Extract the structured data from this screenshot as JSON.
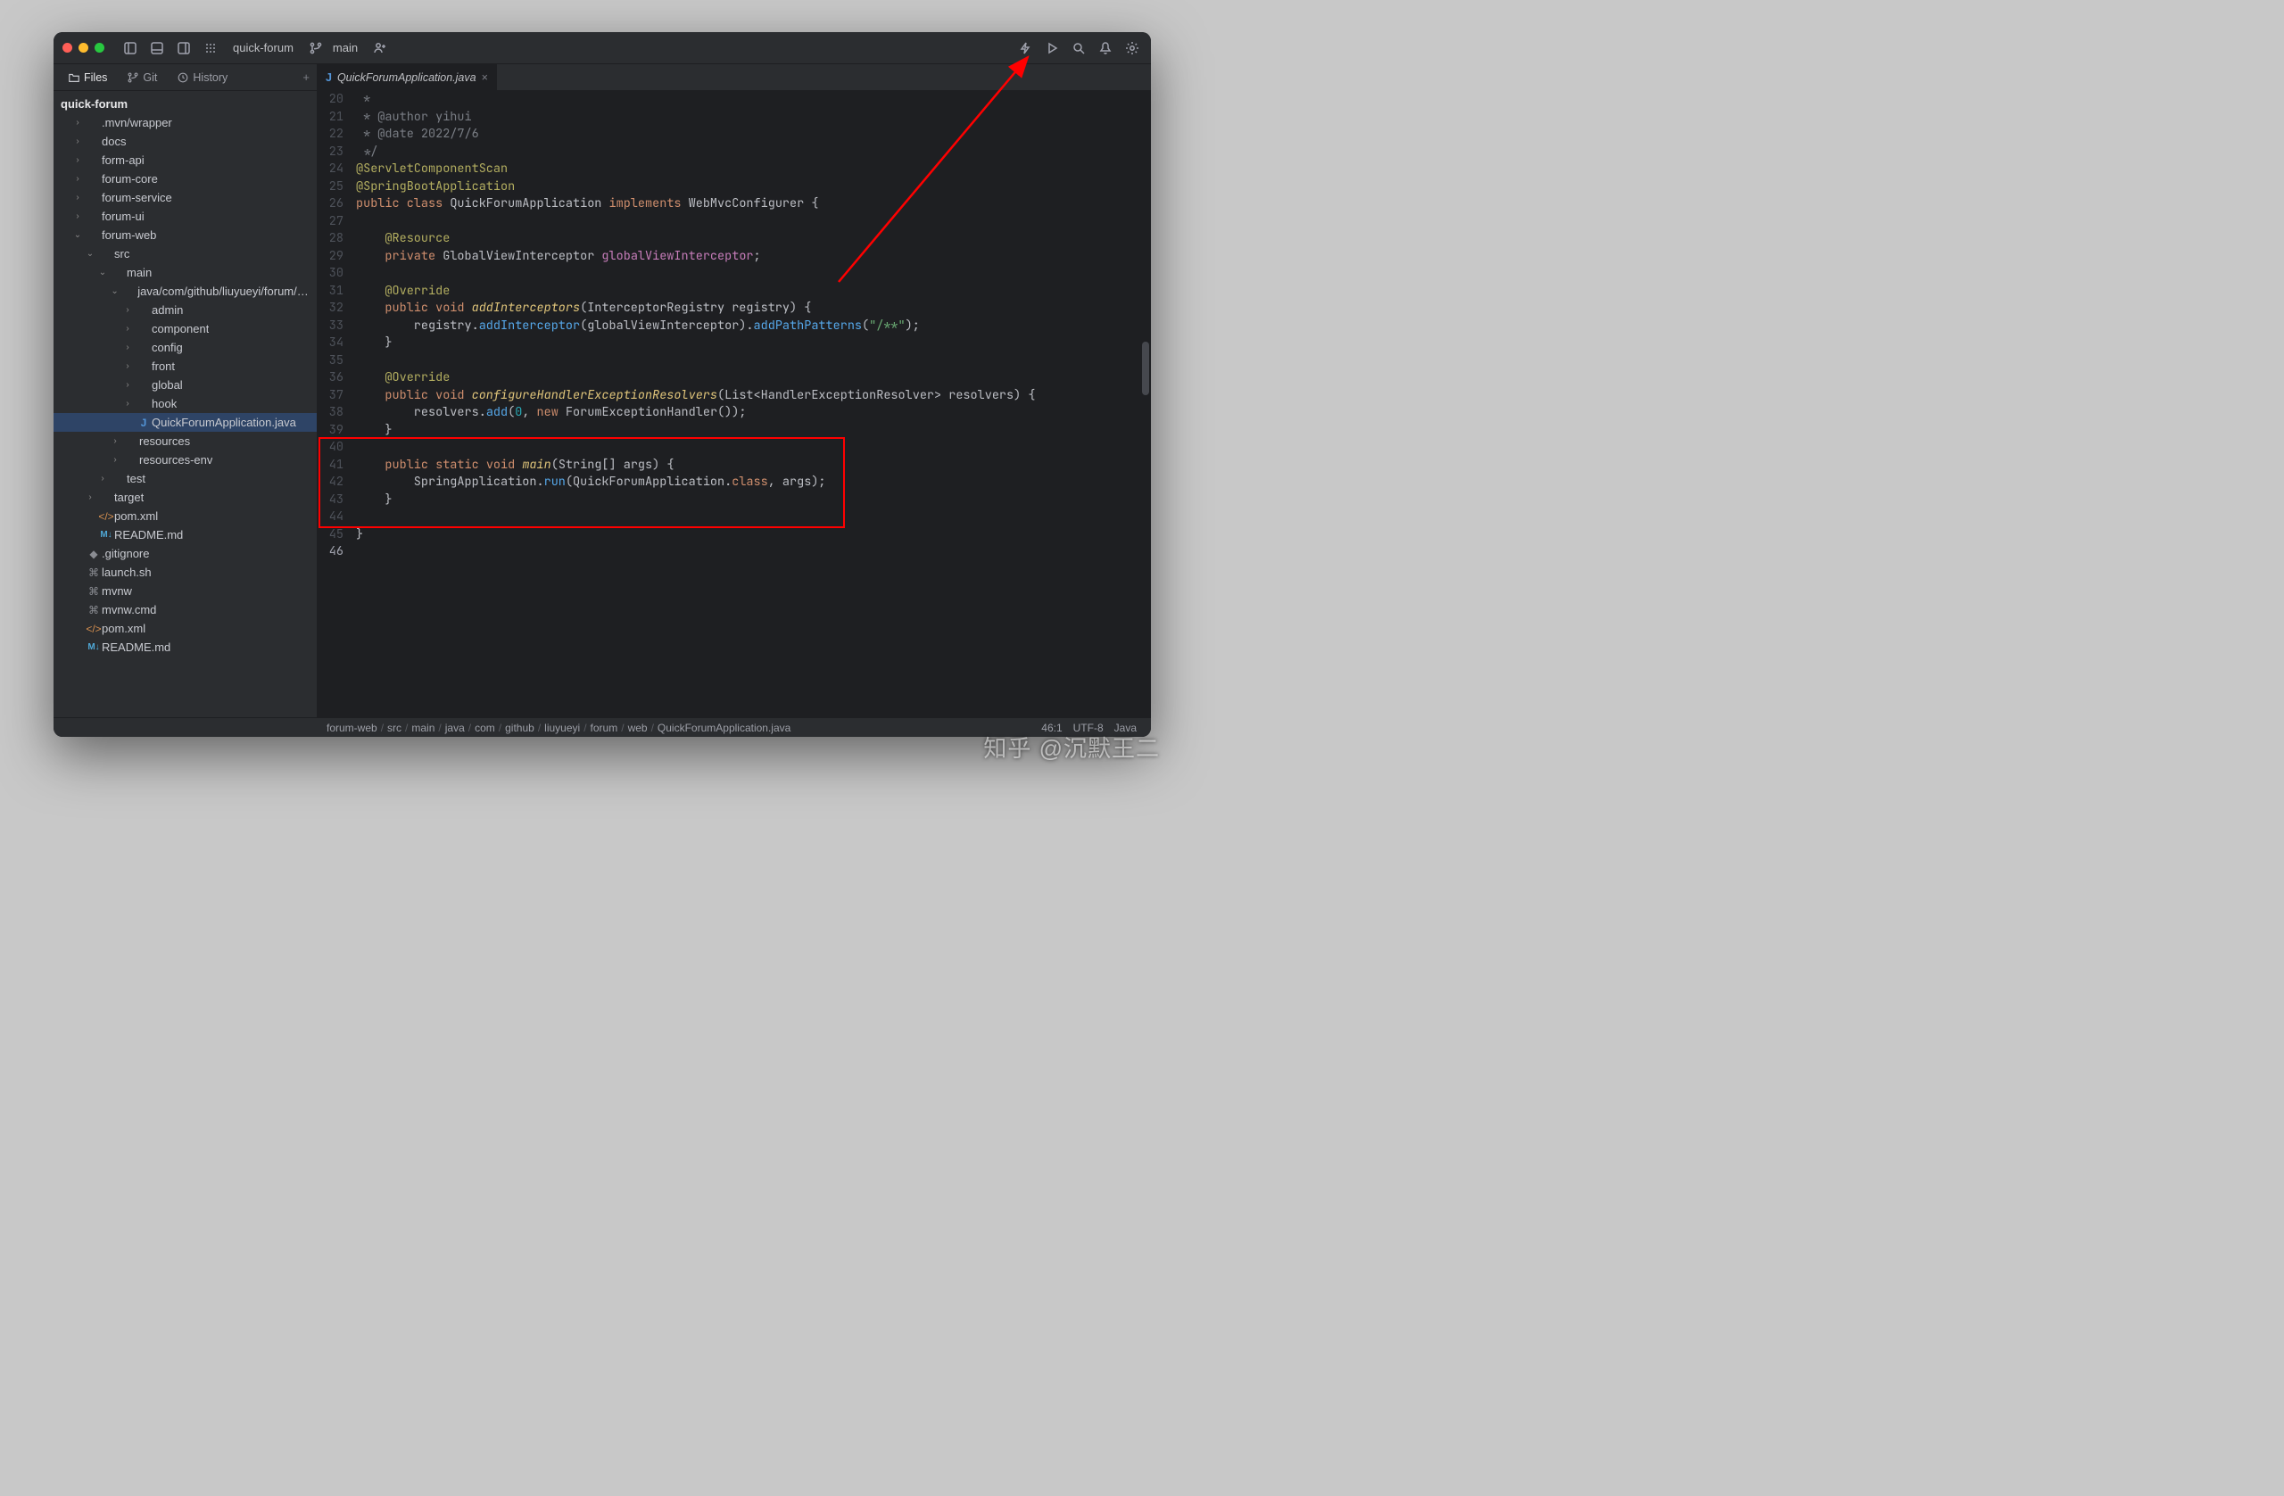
{
  "titlebar": {
    "project": "quick-forum",
    "branch": "main"
  },
  "sidebar_tabs": {
    "files": "Files",
    "git": "Git",
    "history": "History"
  },
  "editor_tab": {
    "icon": "J",
    "name": "QuickForumApplication.java"
  },
  "tree": {
    "root": "quick-forum",
    "nodes": [
      {
        "d": 1,
        "e": "r",
        "i": "folder",
        "l": ".mvn/wrapper"
      },
      {
        "d": 1,
        "e": "r",
        "i": "folder",
        "l": "docs"
      },
      {
        "d": 1,
        "e": "r",
        "i": "folder",
        "l": "form-api"
      },
      {
        "d": 1,
        "e": "r",
        "i": "folder",
        "l": "forum-core"
      },
      {
        "d": 1,
        "e": "r",
        "i": "folder",
        "l": "forum-service"
      },
      {
        "d": 1,
        "e": "r",
        "i": "folder",
        "l": "forum-ui"
      },
      {
        "d": 1,
        "e": "d",
        "i": "folder",
        "l": "forum-web"
      },
      {
        "d": 2,
        "e": "d",
        "i": "folder",
        "l": "src"
      },
      {
        "d": 3,
        "e": "d",
        "i": "folder",
        "l": "main"
      },
      {
        "d": 4,
        "e": "d",
        "i": "folder",
        "l": "java/com/github/liuyueyi/forum/web"
      },
      {
        "d": 5,
        "e": "r",
        "i": "folder",
        "l": "admin"
      },
      {
        "d": 5,
        "e": "r",
        "i": "folder",
        "l": "component"
      },
      {
        "d": 5,
        "e": "r",
        "i": "folder",
        "l": "config"
      },
      {
        "d": 5,
        "e": "r",
        "i": "folder",
        "l": "front"
      },
      {
        "d": 5,
        "e": "r",
        "i": "folder",
        "l": "global"
      },
      {
        "d": 5,
        "e": "r",
        "i": "folder",
        "l": "hook"
      },
      {
        "d": 5,
        "e": " ",
        "i": "java",
        "l": "QuickForumApplication.java",
        "sel": true
      },
      {
        "d": 4,
        "e": "r",
        "i": "folder",
        "l": "resources"
      },
      {
        "d": 4,
        "e": "r",
        "i": "folder",
        "l": "resources-env"
      },
      {
        "d": 3,
        "e": "r",
        "i": "folder",
        "l": "test"
      },
      {
        "d": 2,
        "e": "r",
        "i": "folder",
        "l": "target"
      },
      {
        "d": 2,
        "e": " ",
        "i": "xml",
        "l": "pom.xml"
      },
      {
        "d": 2,
        "e": " ",
        "i": "md",
        "l": "README.md"
      },
      {
        "d": 1,
        "e": " ",
        "i": "git",
        "l": ".gitignore"
      },
      {
        "d": 1,
        "e": " ",
        "i": "sh",
        "l": "launch.sh"
      },
      {
        "d": 1,
        "e": " ",
        "i": "sh",
        "l": "mvnw"
      },
      {
        "d": 1,
        "e": " ",
        "i": "sh",
        "l": "mvnw.cmd"
      },
      {
        "d": 1,
        "e": " ",
        "i": "xml",
        "l": "pom.xml"
      },
      {
        "d": 1,
        "e": " ",
        "i": "md",
        "l": "README.md"
      }
    ]
  },
  "code": {
    "start": 20,
    "lines": [
      [
        [
          "c",
          " *"
        ]
      ],
      [
        [
          "c",
          " * @author yihui"
        ]
      ],
      [
        [
          "c",
          " * @date 2022/7/6"
        ]
      ],
      [
        [
          "c",
          " */"
        ]
      ],
      [
        [
          "a",
          "@ServletComponentScan"
        ]
      ],
      [
        [
          "a",
          "@SpringBootApplication"
        ]
      ],
      [
        [
          "k",
          "public "
        ],
        [
          "k",
          "class "
        ],
        [
          "t",
          "QuickForumApplication "
        ],
        [
          "k",
          "implements "
        ],
        [
          "t",
          "WebMvcConfigurer {"
        ]
      ],
      [
        [
          "t",
          ""
        ]
      ],
      [
        [
          "t",
          "    "
        ],
        [
          "a",
          "@Resource"
        ]
      ],
      [
        [
          "t",
          "    "
        ],
        [
          "k",
          "private "
        ],
        [
          "t",
          "GlobalViewInterceptor "
        ],
        [
          "v",
          "globalViewInterceptor"
        ],
        [
          "t",
          ";"
        ]
      ],
      [
        [
          "t",
          ""
        ]
      ],
      [
        [
          "t",
          "    "
        ],
        [
          "a",
          "@Override"
        ]
      ],
      [
        [
          "t",
          "    "
        ],
        [
          "k",
          "public "
        ],
        [
          "k",
          "void "
        ],
        [
          "fn",
          "addInterceptors"
        ],
        [
          "t",
          "(InterceptorRegistry registry) {"
        ]
      ],
      [
        [
          "t",
          "        registry."
        ],
        [
          "m",
          "addInterceptor"
        ],
        [
          "t",
          "(globalViewInterceptor)."
        ],
        [
          "m",
          "addPathPatterns"
        ],
        [
          "t",
          "("
        ],
        [
          "s",
          "\"/**\""
        ],
        [
          "t",
          ");"
        ]
      ],
      [
        [
          "t",
          "    }"
        ]
      ],
      [
        [
          "t",
          ""
        ]
      ],
      [
        [
          "t",
          "    "
        ],
        [
          "a",
          "@Override"
        ]
      ],
      [
        [
          "t",
          "    "
        ],
        [
          "k",
          "public "
        ],
        [
          "k",
          "void "
        ],
        [
          "fn",
          "configureHandlerExceptionResolvers"
        ],
        [
          "t",
          "(List<HandlerExceptionResolver> resolvers) {"
        ]
      ],
      [
        [
          "t",
          "        resolvers."
        ],
        [
          "m",
          "add"
        ],
        [
          "t",
          "("
        ],
        [
          "n",
          "0"
        ],
        [
          "t",
          ", "
        ],
        [
          "k",
          "new "
        ],
        [
          "t",
          "ForumExceptionHandler());"
        ]
      ],
      [
        [
          "t",
          "    }"
        ]
      ],
      [
        [
          "t",
          ""
        ]
      ],
      [
        [
          "t",
          "    "
        ],
        [
          "k",
          "public "
        ],
        [
          "k",
          "static "
        ],
        [
          "k",
          "void "
        ],
        [
          "fn",
          "main"
        ],
        [
          "t",
          "(String[] args) {"
        ]
      ],
      [
        [
          "t",
          "        SpringApplication."
        ],
        [
          "m",
          "run"
        ],
        [
          "t",
          "(QuickForumApplication."
        ],
        [
          "k",
          "class"
        ],
        [
          "t",
          ", args);"
        ]
      ],
      [
        [
          "t",
          "    }"
        ]
      ],
      [
        [
          "t",
          ""
        ]
      ],
      [
        [
          "t",
          "}"
        ]
      ],
      [
        [
          "t",
          ""
        ]
      ]
    ],
    "hidden_after": 44,
    "current_line": 46
  },
  "breadcrumbs": [
    "forum-web",
    "src",
    "main",
    "java",
    "com",
    "github",
    "liuyueyi",
    "forum",
    "web",
    "QuickForumApplication.java"
  ],
  "status": {
    "pos": "46:1",
    "enc": "UTF-8",
    "lang": "Java"
  },
  "watermark": "知乎 @沉默王二"
}
